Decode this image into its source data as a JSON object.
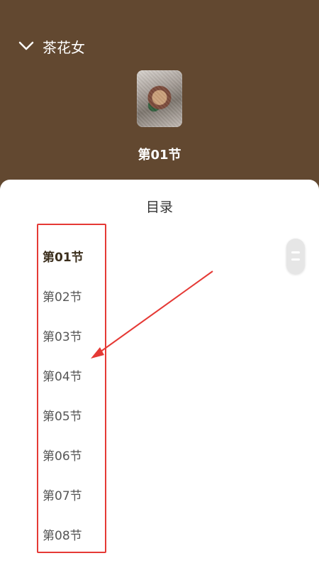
{
  "header": {
    "book_name": "茶花女",
    "current_chapter": "第01节"
  },
  "sheet": {
    "title": "目录",
    "items": [
      {
        "label": "第01节",
        "active": true
      },
      {
        "label": "第02节",
        "active": false
      },
      {
        "label": "第03节",
        "active": false
      },
      {
        "label": "第04节",
        "active": false
      },
      {
        "label": "第05节",
        "active": false
      },
      {
        "label": "第06节",
        "active": false
      },
      {
        "label": "第07节",
        "active": false
      },
      {
        "label": "第08节",
        "active": false
      }
    ]
  },
  "colors": {
    "header_bg": "#624830",
    "annotation_red": "#e53935"
  },
  "icons": {
    "back": "chevron-down-icon",
    "scroll": "scroll-handle-icon"
  }
}
